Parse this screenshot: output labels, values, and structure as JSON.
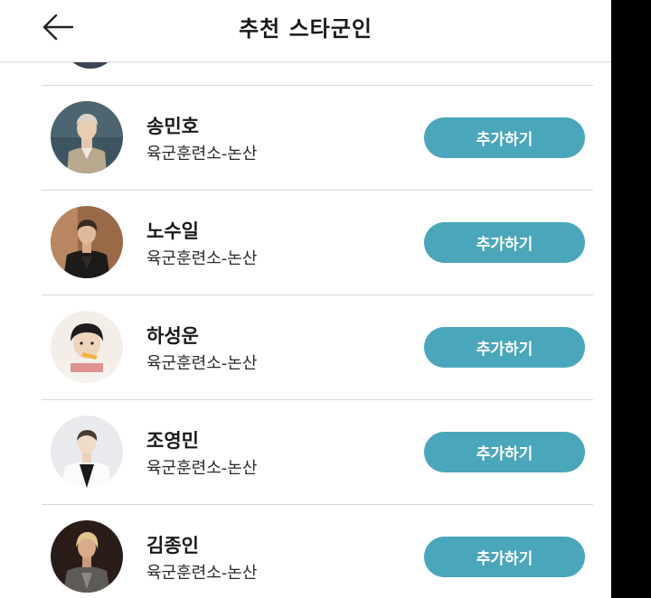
{
  "header": {
    "title": "추천 스타군인",
    "back_icon": "arrow-left-icon"
  },
  "recommendations": [
    {
      "name": "송민호",
      "unit": "육군훈련소-논산",
      "button": "추가하기"
    },
    {
      "name": "노수일",
      "unit": "육군훈련소-논산",
      "button": "추가하기"
    },
    {
      "name": "하성운",
      "unit": "육군훈련소-논산",
      "button": "추가하기"
    },
    {
      "name": "조영민",
      "unit": "육군훈련소-논산",
      "button": "추가하기"
    },
    {
      "name": "김종인",
      "unit": "육군훈련소-논산",
      "button": "추가하기"
    }
  ],
  "colors": {
    "accent": "#4aa6ba",
    "divider": "#d8d8d8",
    "text": "#1a1a1a"
  }
}
